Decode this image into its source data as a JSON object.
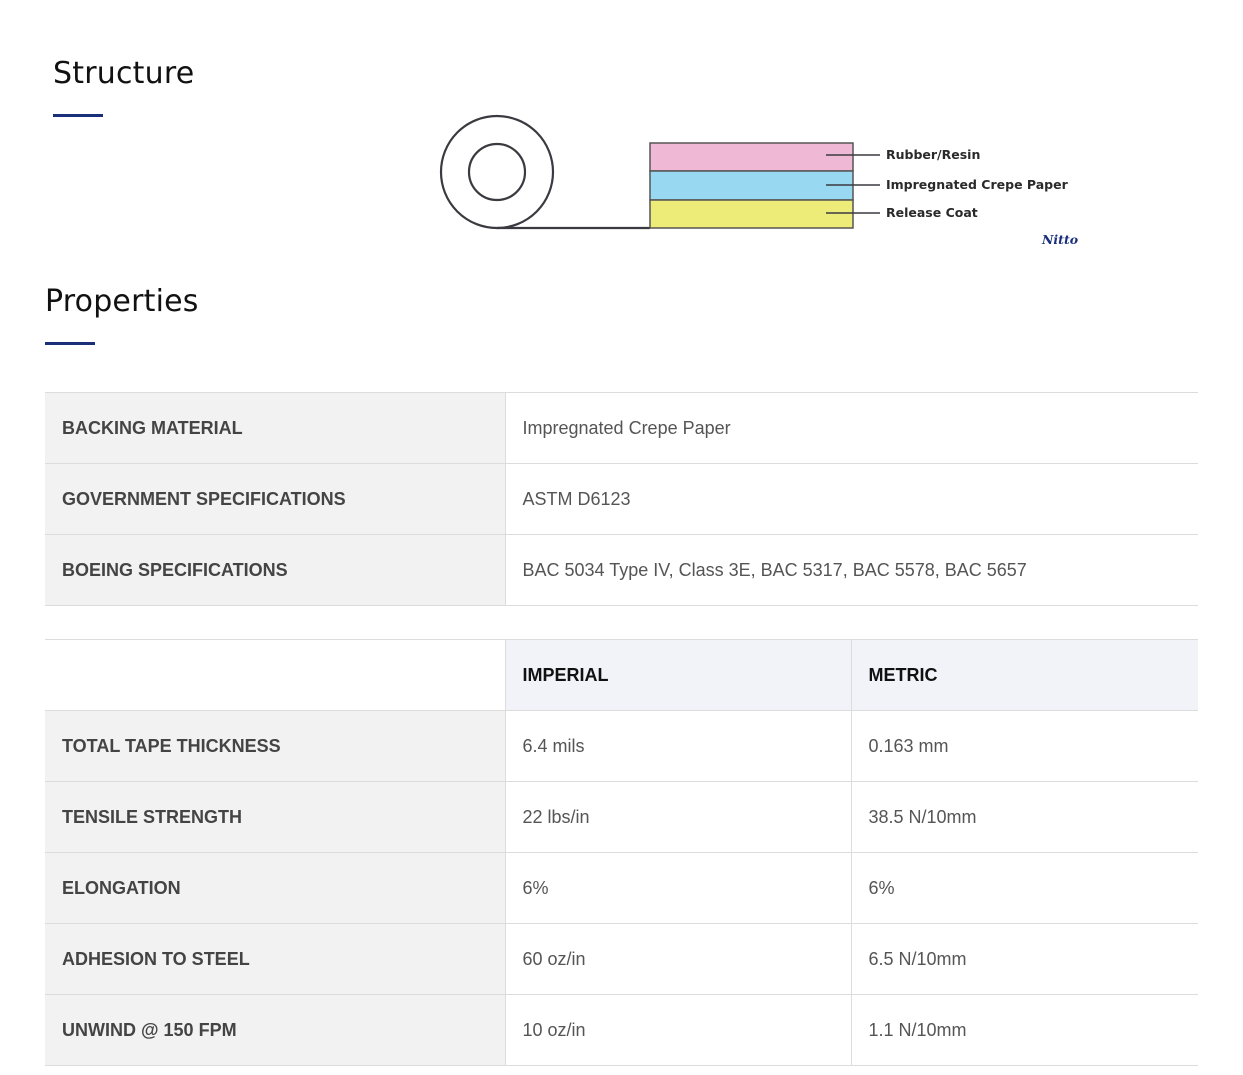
{
  "structure": {
    "title": "Structure",
    "diagram": {
      "layers": [
        {
          "label": "Rubber/Resin",
          "color": "#efb8d4"
        },
        {
          "label": "Impregnated Crepe Paper",
          "color": "#98d8f0"
        },
        {
          "label": "Release Coat",
          "color": "#eeec78"
        }
      ],
      "logo_text": "Nitto",
      "logo_color": "#1a2f7a"
    }
  },
  "properties": {
    "title": "Properties",
    "spec_rows": [
      {
        "label": "BACKING MATERIAL",
        "value": "Impregnated Crepe Paper"
      },
      {
        "label": "GOVERNMENT SPECIFICATIONS",
        "value": "ASTM D6123"
      },
      {
        "label": "BOEING SPECIFICATIONS",
        "value": "BAC 5034 Type IV, Class 3E, BAC 5317, BAC 5578, BAC 5657"
      }
    ],
    "perf_table": {
      "headers": [
        "",
        "IMPERIAL",
        "METRIC"
      ],
      "rows": [
        {
          "label": "TOTAL TAPE THICKNESS",
          "imperial": "6.4 mils",
          "metric": "0.163 mm"
        },
        {
          "label": "TENSILE STRENGTH",
          "imperial": "22 lbs/in",
          "metric": "38.5 N/10mm"
        },
        {
          "label": "ELONGATION",
          "imperial": "6%",
          "metric": "6%"
        },
        {
          "label": "ADHESION TO STEEL",
          "imperial": "60 oz/in",
          "metric": "6.5 N/10mm"
        },
        {
          "label": "UNWIND @ 150 FPM",
          "imperial": "10 oz/in",
          "metric": "1.1 N/10mm"
        }
      ]
    }
  },
  "colors": {
    "accent_underline": "#1a2f7a",
    "label_cell_bg": "#f2f2f2",
    "header_cell_bg": "#f2f3f8",
    "border": "#dcdcdc"
  }
}
